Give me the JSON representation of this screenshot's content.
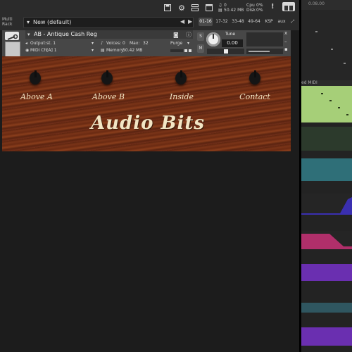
{
  "kontakt_header": {
    "rack_label": "Multi\nRack",
    "preset_name": "New (default)",
    "preset_arrow": "▾",
    "prev": "◀",
    "next": "▶",
    "page_tabs": [
      "01-16",
      "17-32",
      "33-48",
      "49-64",
      "KSP",
      "aux"
    ],
    "active_tab": "01-16",
    "midi_count": "0",
    "memory": "50.42 MB",
    "cpu_label": "Cpu",
    "cpu_value": "0%",
    "disk_label": "Disk",
    "disk_value": "0%",
    "alert": "!"
  },
  "instrument": {
    "name": "AB - Antique Cash Reg",
    "output_label": "Output:",
    "output_value": "st. 1",
    "voices_label": "Voices:",
    "voices_value": "0",
    "max_label": "Max:",
    "max_value": "32",
    "purge_label": "Purge",
    "midi_label": "MIDI Ch:",
    "midi_value": "[A] 1",
    "memory_label": "Memory:",
    "memory_value": "50.42 MB",
    "tune_label": "Tune",
    "tune_value": "0.00",
    "solo": "S",
    "mute": "M",
    "close": "x"
  },
  "panel": {
    "knobs": [
      "Above A",
      "Above B",
      "Inside",
      "Contact"
    ],
    "brand": "Audio Bits"
  },
  "right_panel": {
    "ruler": "0.08.00",
    "midi_clip": "ed MIDI"
  },
  "colors": {
    "green": "#a6cf78",
    "teal": "#2f6f78",
    "blue": "#3a2fb0",
    "pink": "#b02f6a",
    "purple": "#6a2fb0"
  }
}
